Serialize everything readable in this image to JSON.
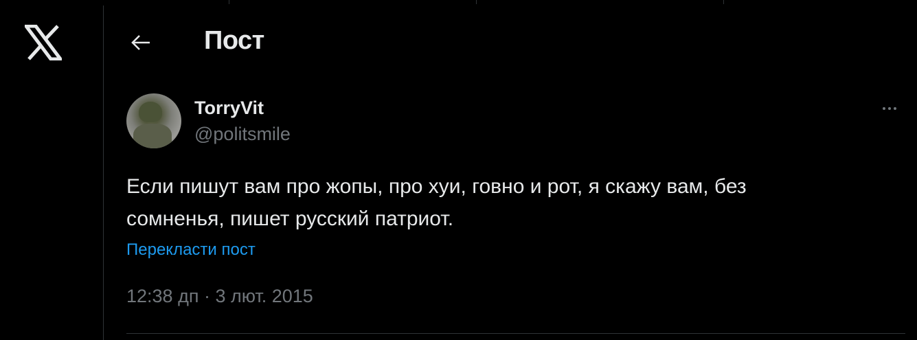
{
  "header": {
    "title": "Пост"
  },
  "post": {
    "author": {
      "name": "TorryVit",
      "handle": "@politsmile"
    },
    "text_line1": "Если пишут вам про жопы, про хуи, говно и рот, я скажу вам, без",
    "text_line2": "сомненья, пишет русский патриот.",
    "translate_label": "Перекласти пост",
    "time": "12:38 дп",
    "separator": " · ",
    "date": "3 лют. 2015"
  },
  "icons": {
    "logo": "x-logo-icon",
    "back": "arrow-left-icon",
    "more": "more-horizontal-icon"
  },
  "colors": {
    "background": "#000000",
    "text": "#e7e9ea",
    "muted": "#71767b",
    "link": "#1d9bf0",
    "border": "#2f3336"
  }
}
